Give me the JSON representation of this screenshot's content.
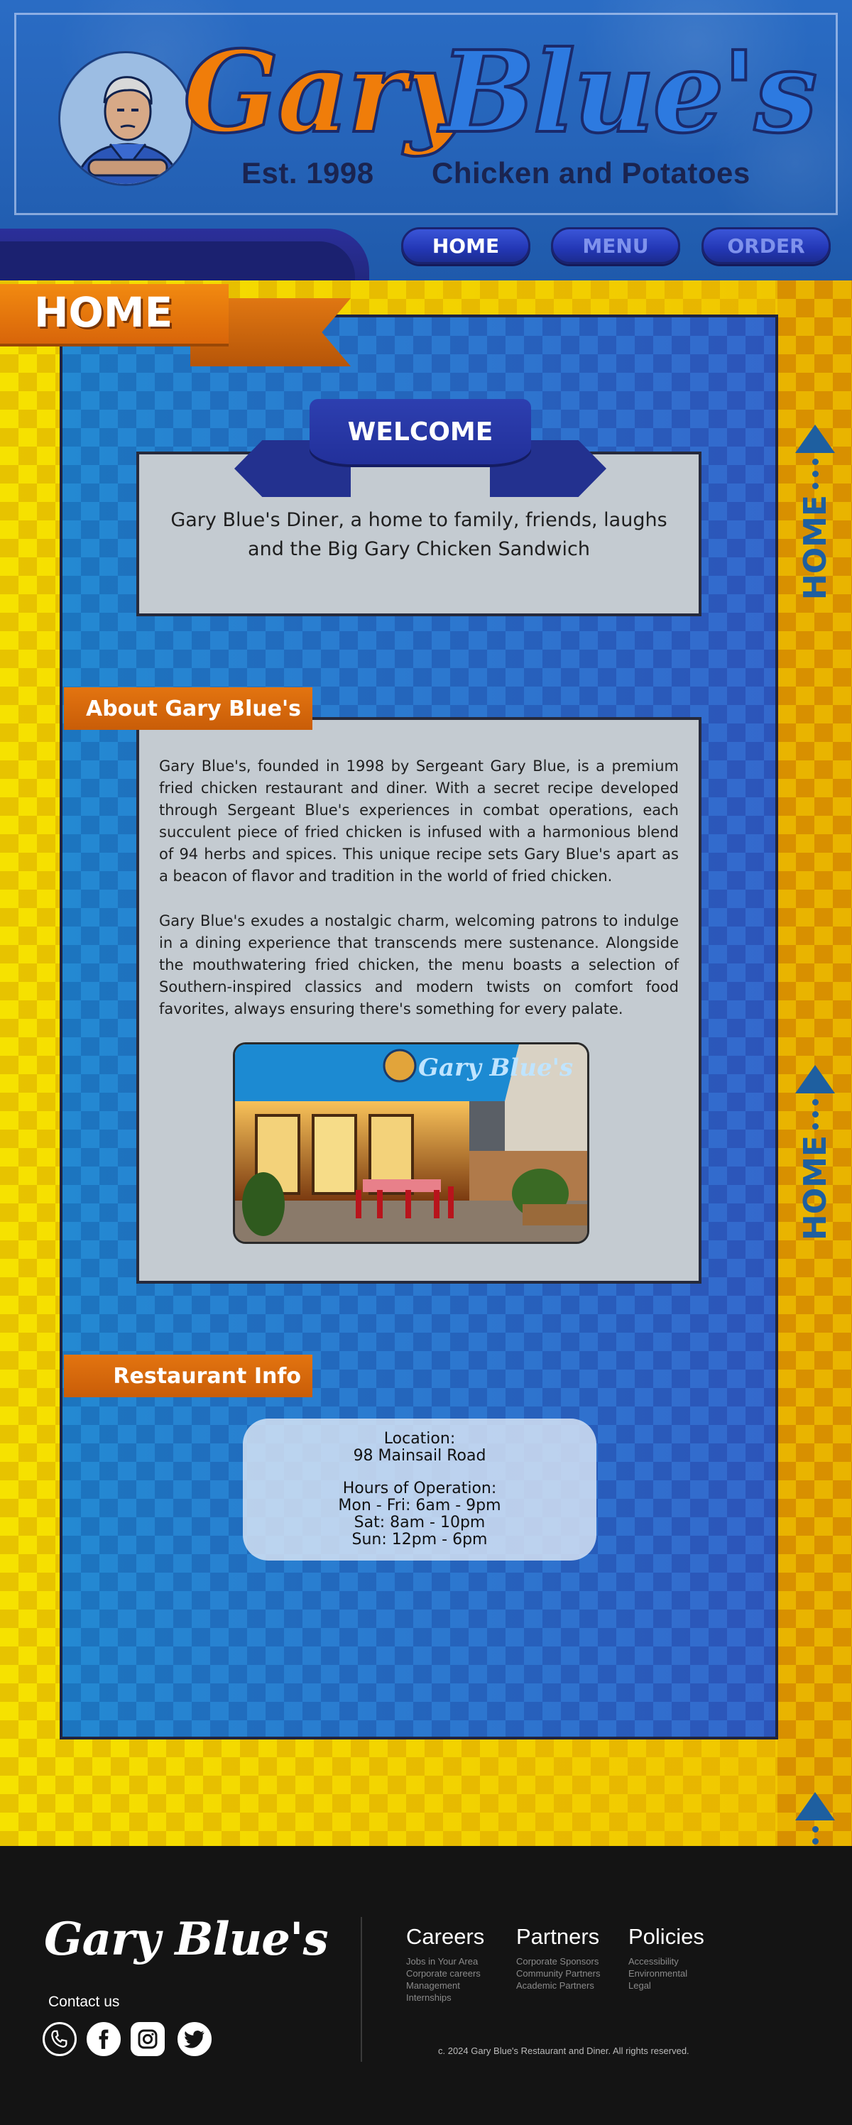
{
  "header": {
    "logo_part1": "Gary",
    "logo_part2": "Blue's",
    "tagline_est": "Est. 1998",
    "tagline_food": "Chicken and Potatoes",
    "nav": [
      {
        "label": "HOME"
      },
      {
        "label": "MENU"
      },
      {
        "label": "ORDER"
      }
    ]
  },
  "page": {
    "title": "HOME",
    "side_label": "HOME"
  },
  "welcome": {
    "banner": "WELCOME",
    "text": "Gary Blue's Diner, a home to family, friends, laughs and the Big Gary Chicken Sandwich"
  },
  "about": {
    "heading": "About Gary Blue's",
    "p1": "Gary Blue's, founded in 1998 by Sergeant Gary Blue, is a premium fried chicken restaurant and diner. With a secret recipe developed through Sergeant Blue's experiences in combat operations, each succulent piece of fried chicken is infused with a harmonious blend of 94 herbs and spices. This unique recipe sets Gary Blue's apart as a beacon of flavor and tradition in the world of fried chicken.",
    "p2": "Gary Blue's exudes a nostalgic charm, welcoming patrons to indulge in a dining experience that transcends mere sustenance. Alongside the mouthwatering fried chicken, the menu boasts a selection of Southern-inspired classics and modern twists on comfort food favorites, always ensuring there's something for every palate.",
    "photo_sign": "Gary Blue's"
  },
  "info": {
    "heading": "Restaurant Info",
    "location_label": "Location:",
    "address": "98 Mainsail Road",
    "hours_label": "Hours of Operation:",
    "hours": [
      "Mon - Fri: 6am - 9pm",
      "Sat: 8am - 10pm",
      "Sun: 12pm - 6pm"
    ]
  },
  "footer": {
    "logo": "Gary Blue's",
    "contact": "Contact us",
    "social_icons": [
      "phone-icon",
      "facebook-icon",
      "instagram-icon",
      "twitter-icon"
    ],
    "columns": [
      {
        "title": "Careers",
        "links": [
          "Jobs in Your Area",
          "Corporate careers",
          "Management",
          "Internships"
        ]
      },
      {
        "title": "Partners",
        "links": [
          "Corporate Sponsors",
          "Community Partners",
          "Academic Partners"
        ]
      },
      {
        "title": "Policies",
        "links": [
          "Accessibility",
          "Environmental",
          "Legal"
        ]
      }
    ],
    "copyright": "c. 2024  Gary Blue's Restaurant and Diner.  All rights reserved."
  },
  "colors": {
    "header_blue": "#2563b8",
    "accent_orange": "#e37410",
    "brand_yellow": "#f1d900",
    "navy": "#23318f",
    "footer": "#141414"
  }
}
